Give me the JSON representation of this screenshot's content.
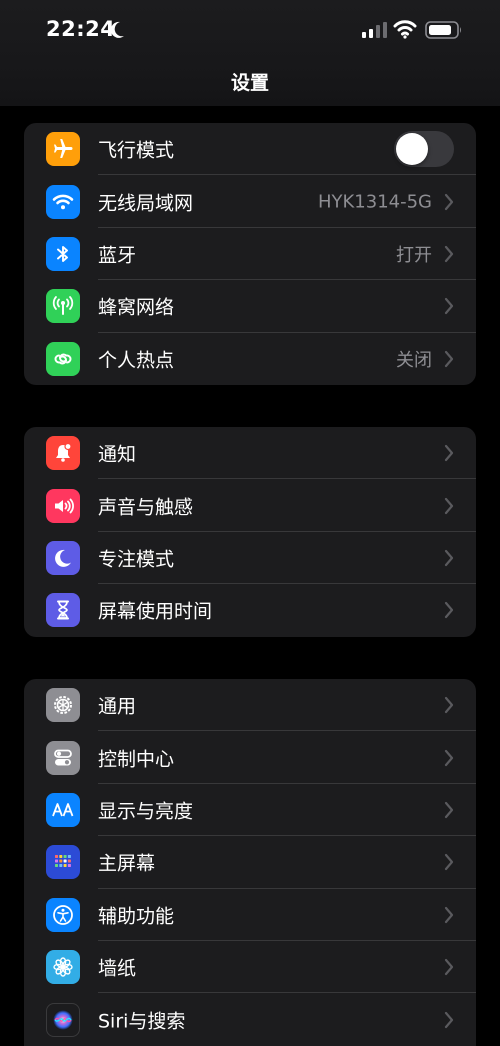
{
  "status_bar": {
    "time": "22:24"
  },
  "header": {
    "title": "设置"
  },
  "groups": [
    {
      "items": [
        {
          "label": "飞行模式",
          "icon": "airplane-icon",
          "color": "#ff9f0a",
          "toggle": false
        },
        {
          "label": "无线局域网",
          "icon": "wifi-icon",
          "color": "#0a84ff",
          "value": "HYK1314-5G"
        },
        {
          "label": "蓝牙",
          "icon": "bluetooth-icon",
          "color": "#0a84ff",
          "value": "打开"
        },
        {
          "label": "蜂窝网络",
          "icon": "antenna-icon",
          "color": "#30d158",
          "value": ""
        },
        {
          "label": "个人热点",
          "icon": "hotspot-icon",
          "color": "#30d158",
          "value": "关闭"
        }
      ]
    },
    {
      "items": [
        {
          "label": "通知",
          "icon": "bell-icon",
          "color": "#ff453a"
        },
        {
          "label": "声音与触感",
          "icon": "speaker-icon",
          "color": "#ff375f"
        },
        {
          "label": "专注模式",
          "icon": "moon-icon",
          "color": "#5e5ce6"
        },
        {
          "label": "屏幕使用时间",
          "icon": "hourglass-icon",
          "color": "#5e5ce6"
        }
      ]
    },
    {
      "items": [
        {
          "label": "通用",
          "icon": "gear-icon",
          "color": "#8e8e93"
        },
        {
          "label": "控制中心",
          "icon": "switches-icon",
          "color": "#8e8e93"
        },
        {
          "label": "显示与亮度",
          "icon": "text-size-icon",
          "color": "#0a84ff"
        },
        {
          "label": "主屏幕",
          "icon": "home-grid-icon",
          "color": "#2c4bd6"
        },
        {
          "label": "辅助功能",
          "icon": "accessibility-icon",
          "color": "#0a84ff"
        },
        {
          "label": "墙纸",
          "icon": "flower-icon",
          "color": "#32ade6"
        },
        {
          "label": "Siri与搜索",
          "icon": "siri-icon",
          "color": "#1c1c1e"
        }
      ]
    }
  ]
}
